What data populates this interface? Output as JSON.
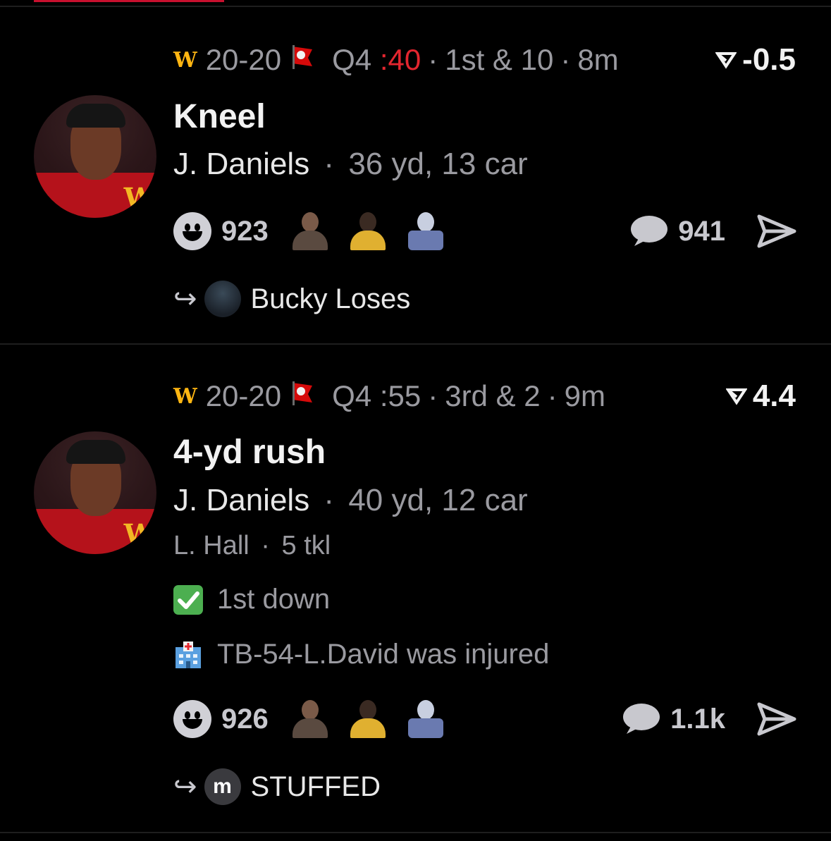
{
  "feed": {
    "plays": [
      {
        "team_abbr": "W",
        "score": "20-20",
        "quarter": "Q4",
        "clock": ":40",
        "clock_is_red": true,
        "down": "1st & 10",
        "age": "8m",
        "wp_delta": "-0.5",
        "title": "Kneel",
        "player": "J. Daniels",
        "player_stats": "36 yd, 13 car",
        "reactions_count": "923",
        "comments_count": "941",
        "reply_user": "Bucky Loses"
      },
      {
        "team_abbr": "W",
        "score": "20-20",
        "quarter": "Q4",
        "clock": ":55",
        "clock_is_red": false,
        "down": "3rd & 2",
        "age": "9m",
        "wp_delta": "4.4",
        "title": "4-yd rush",
        "player": "J. Daniels",
        "player_stats": "40 yd, 12 car",
        "tackler": "L. Hall",
        "tackler_stats": "5 tkl",
        "note_first_down": "1st down",
        "note_injury": "TB-54-L.David was injured",
        "reactions_count": "926",
        "comments_count": "1.1k",
        "reply_user": "STUFFED",
        "reply_avatar_letter": "m"
      }
    ],
    "separator": "·"
  },
  "colors": {
    "accent_red": "#e3262f",
    "washington_gold": "#ffb612",
    "bucs_red": "#d50a0a"
  },
  "icons": [
    "washington-logo-icon",
    "buccaneers-flag-icon",
    "win-probability-icon",
    "smiley-icon",
    "comment-bubble-icon",
    "send-icon",
    "reply-arrow-icon",
    "check-icon",
    "hospital-icon"
  ]
}
